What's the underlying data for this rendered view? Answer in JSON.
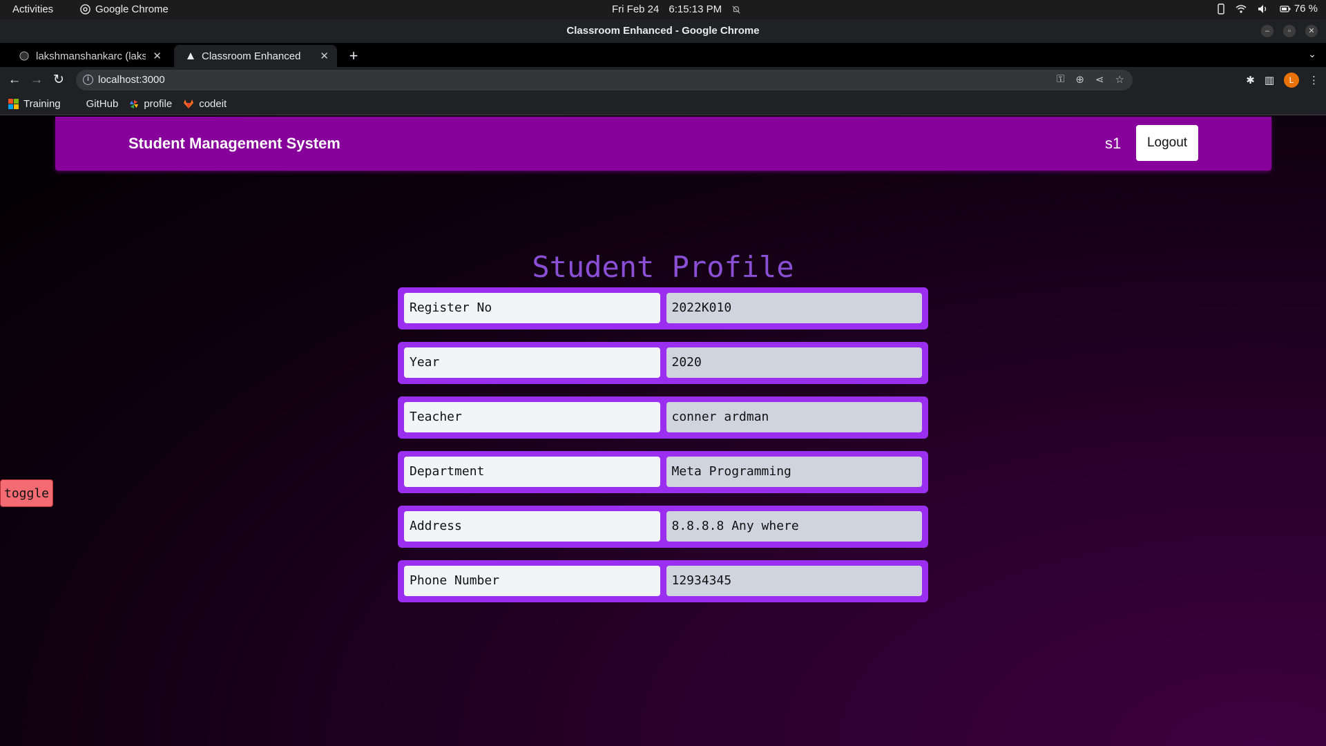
{
  "system": {
    "activities": "Activities",
    "app_name": "Google Chrome",
    "date": "Fri Feb 24",
    "time": "6:15:13 PM",
    "battery": "76 %"
  },
  "window": {
    "title": "Classroom Enhanced - Google Chrome"
  },
  "tabs": [
    {
      "title": "lakshmanshankarc (laksh"
    },
    {
      "title": "Classroom Enhanced"
    }
  ],
  "address_bar": {
    "url": "localhost:3000"
  },
  "profile_avatar": "L",
  "bookmarks": [
    {
      "label": "Training"
    },
    {
      "label": "GitHub"
    },
    {
      "label": "profile"
    },
    {
      "label": "codeit"
    }
  ],
  "app": {
    "brand": "Student Management System",
    "username": "s1",
    "logout_label": "Logout",
    "toggle_label": "toggle",
    "profile_title": "Student Profile",
    "fields": [
      {
        "label": "Register No",
        "value": "2022K010"
      },
      {
        "label": "Year",
        "value": "2020"
      },
      {
        "label": "Teacher",
        "value": "conner ardman"
      },
      {
        "label": "Department",
        "value": "Meta Programming"
      },
      {
        "label": "Address",
        "value": "8.8.8.8 Any where"
      },
      {
        "label": "Phone Number",
        "value": "12934345"
      }
    ]
  },
  "colors": {
    "navbar": "#88009b",
    "row": "#9a2ff0",
    "title": "#8b4fd6",
    "toggle": "#f46b73"
  }
}
